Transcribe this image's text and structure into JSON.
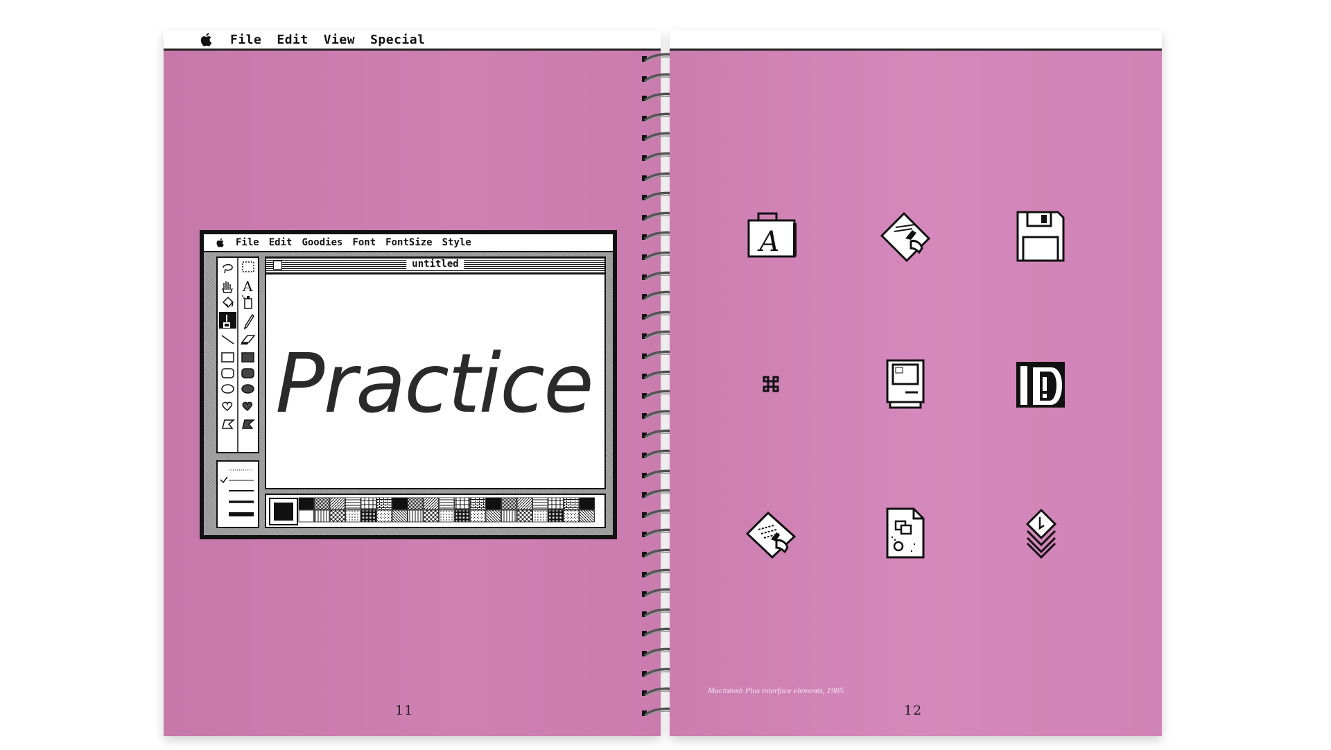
{
  "left_page": {
    "menu": {
      "items": [
        "File",
        "Edit",
        "View",
        "Special"
      ]
    },
    "page_number": "11",
    "paint_window": {
      "menu": {
        "items": [
          "File",
          "Edit",
          "Goodies",
          "Font",
          "FontSize",
          "Style"
        ]
      },
      "document_title": "untitled",
      "canvas_text": "Practice",
      "tools": [
        "lasso-icon",
        "selection-rect-icon",
        "hand-icon",
        "text-tool-icon",
        "paint-bucket-icon",
        "spray-can-icon",
        "paintbrush-icon",
        "pencil-icon",
        "line-tool-icon",
        "eraser-icon",
        "rectangle-icon",
        "filled-rectangle-icon",
        "rounded-rect-icon",
        "filled-rounded-rect-icon",
        "oval-icon",
        "filled-oval-icon",
        "freeform-icon",
        "filled-freeform-icon",
        "polygon-icon",
        "filled-polygon-icon"
      ]
    }
  },
  "right_page": {
    "page_number": "12",
    "caption": "Macintosh Plus interface elements, 1985.",
    "icons": [
      "font-suitcase-icon",
      "macpaint-document-icon",
      "floppy-disk-icon",
      "command-key-icon",
      "macintosh-computer-icon",
      "application-icon",
      "write-document-icon",
      "draw-document-icon",
      "stack-icon"
    ]
  },
  "colors": {
    "page": "#cf80b3",
    "ink": "#111111",
    "menubar": "#ffffff"
  }
}
